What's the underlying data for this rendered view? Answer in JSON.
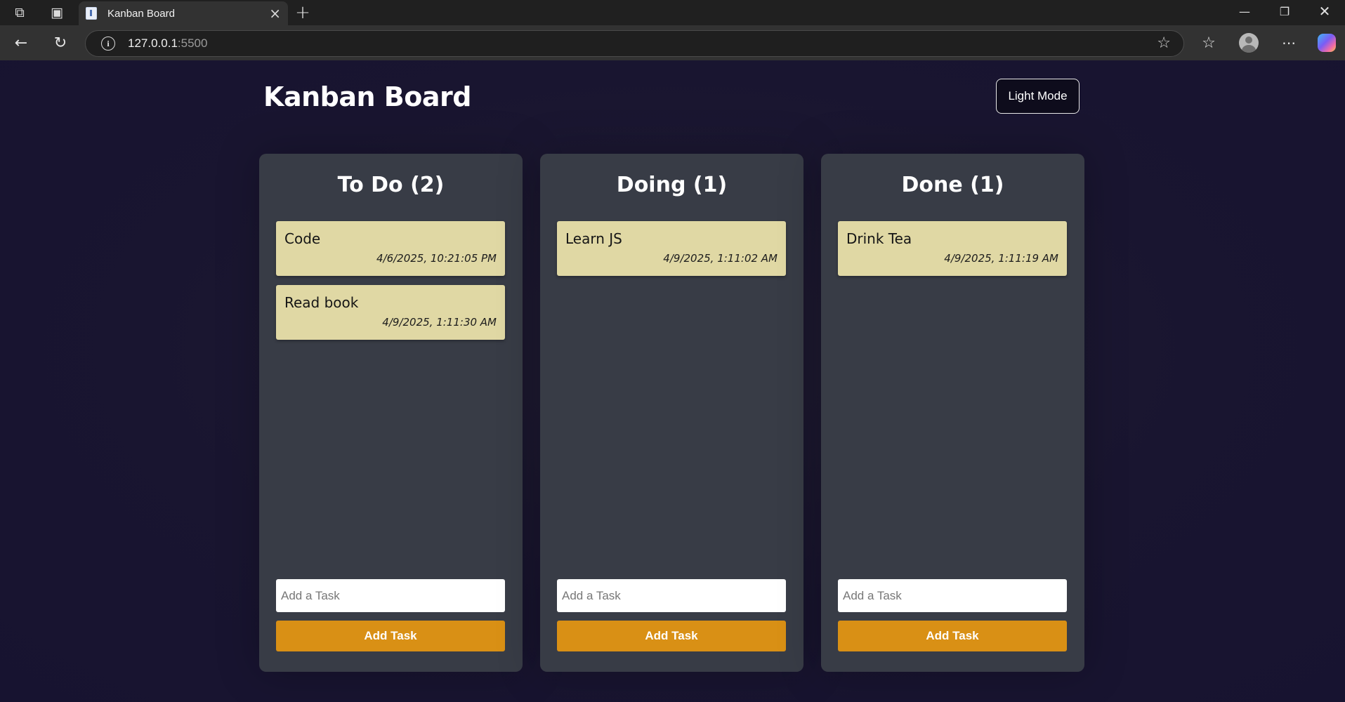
{
  "browser": {
    "tab_title": "Kanban Board",
    "url_host": "127.0.0.1",
    "url_port": ":5500"
  },
  "header": {
    "title": "Kanban Board",
    "mode_button": "Light Mode"
  },
  "columns": [
    {
      "title": "To Do",
      "count": "2",
      "cards": [
        {
          "name": "Code",
          "date": "4/6/2025, 10:21:05 PM"
        },
        {
          "name": "Read book",
          "date": "4/9/2025, 1:11:30 AM"
        }
      ],
      "input_placeholder": "Add a Task",
      "button_label": "Add Task"
    },
    {
      "title": "Doing",
      "count": "1",
      "cards": [
        {
          "name": "Learn JS",
          "date": "4/9/2025, 1:11:02 AM"
        }
      ],
      "input_placeholder": "Add a Task",
      "button_label": "Add Task"
    },
    {
      "title": "Done",
      "count": "1",
      "cards": [
        {
          "name": "Drink Tea",
          "date": "4/9/2025, 1:11:19 AM"
        }
      ],
      "input_placeholder": "Add a Task",
      "button_label": "Add Task"
    }
  ],
  "colors": {
    "page_bg": "#181530",
    "column_bg": "#383c46",
    "card_bg": "#e0d8a4",
    "accent": "#d99015"
  }
}
